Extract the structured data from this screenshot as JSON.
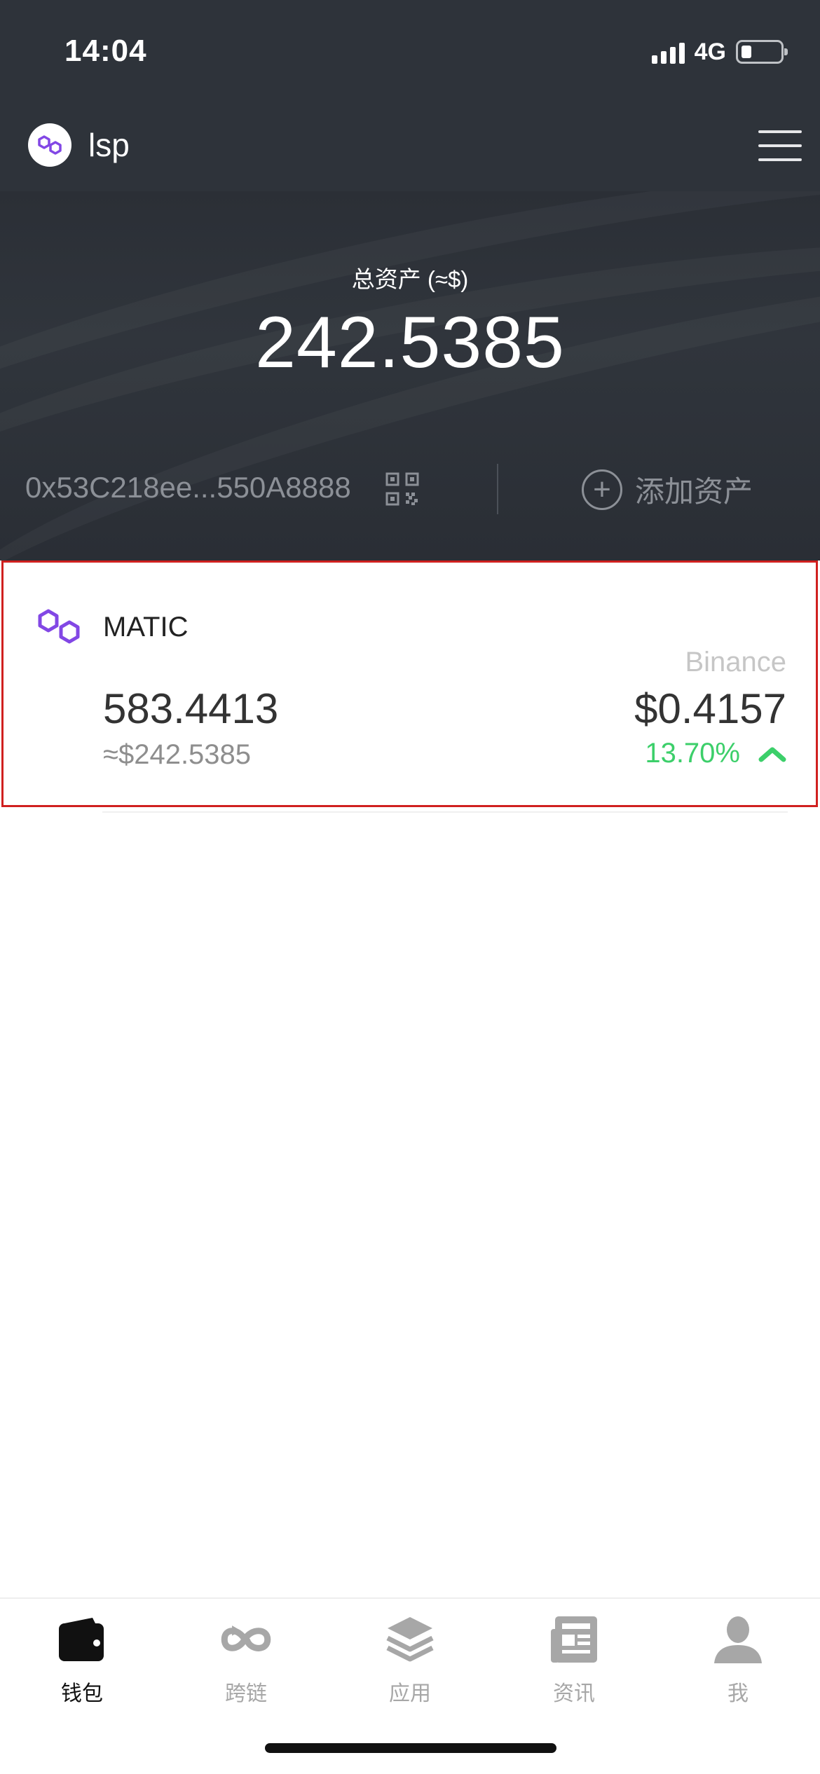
{
  "status": {
    "time": "14:04",
    "network": "4G"
  },
  "header": {
    "app_name": "lsp",
    "logo_icon": "polygon-logo-icon",
    "menu_icon": "hamburger-menu-icon"
  },
  "summary": {
    "total_label": "总资产 (≈$)",
    "total_value": "242.5385",
    "address": "0x53C218ee...550A8888",
    "qr_icon": "qr-code-icon",
    "add_asset_label": "添加资产"
  },
  "assets": [
    {
      "name": "MATIC",
      "icon": "polygon-matic-icon",
      "exchange": "Binance",
      "balance": "583.4413",
      "fiat_value": "≈$242.5385",
      "price": "$0.4157",
      "change": "13.70%",
      "change_direction": "up"
    }
  ],
  "tabbar": {
    "tabs": [
      {
        "label": "钱包",
        "icon": "wallet-icon",
        "active": true
      },
      {
        "label": "跨链",
        "icon": "cross-chain-icon",
        "active": false
      },
      {
        "label": "应用",
        "icon": "apps-layers-icon",
        "active": false
      },
      {
        "label": "资讯",
        "icon": "news-icon",
        "active": false
      },
      {
        "label": "我",
        "icon": "profile-icon",
        "active": false
      }
    ]
  },
  "colors": {
    "header_bg": "#2e333a",
    "brand_purple": "#8247e5",
    "up_green": "#3ccf6a",
    "highlight_red": "#d0201f"
  }
}
